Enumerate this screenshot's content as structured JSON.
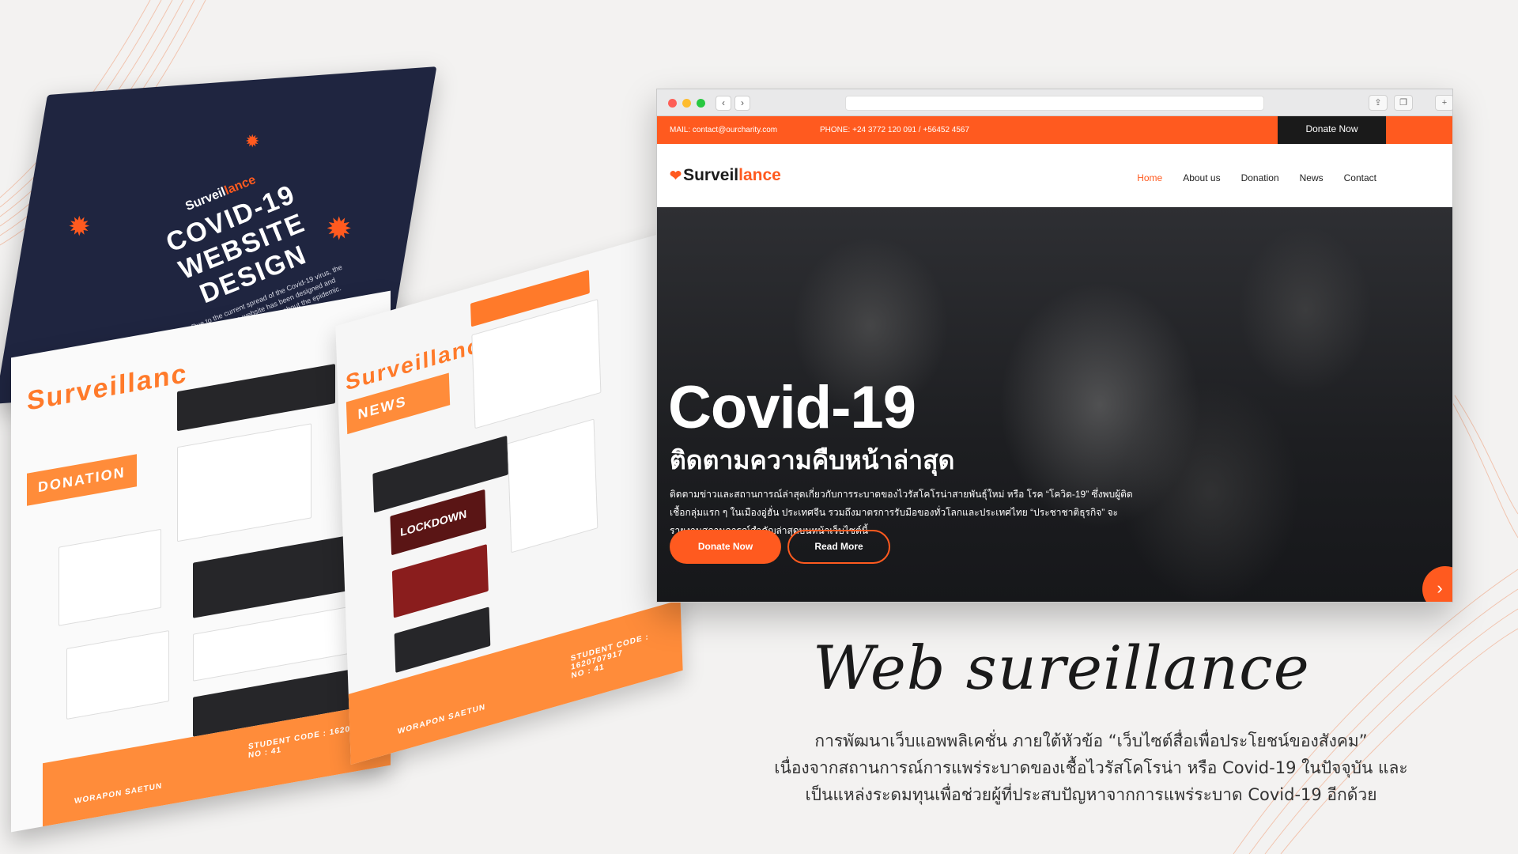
{
  "colors": {
    "accent": "#ff5a1f",
    "dark": "#1a1a1a",
    "navy": "#1f2540",
    "background": "#f3f2f1"
  },
  "magazine": {
    "cover": {
      "logo_prefix": "Surveil",
      "logo_accent": "lance",
      "title_line1": "COVID-19",
      "title_line2": "WEBSITE DESIGN",
      "description": "Due to the current spread of the Covid-19 virus, the surveillance website has been designed and developed to report news about the epidemic."
    },
    "left_page": {
      "title": "Surveillanc",
      "section": "DONATION",
      "student_code": "STUDENT CODE : 1620707917",
      "number": "NO : 41",
      "author": "WORAPON SAETUN"
    },
    "right_page": {
      "title": "Surveillanc",
      "section": "NEWS",
      "lockdown": "LOCKDOWN",
      "student_code": "STUDENT CODE : 1620707917",
      "number": "NO : 41",
      "author": "WORAPON SAETUN"
    }
  },
  "browser": {
    "nav_back_icon": "chevron-left-icon",
    "nav_forward_icon": "chevron-right-icon",
    "topbar": {
      "mail": "MAIL: contact@ourcharity.com",
      "phone": "PHONE: +24 3772 120 091 / +56452 4567",
      "donate_label": "Donate Now"
    },
    "site": {
      "logo_prefix": "Surveil",
      "logo_accent": "lance",
      "menu": [
        "Home",
        "About us",
        "Donation",
        "News",
        "Contact"
      ]
    },
    "hero": {
      "title": "Covid-19",
      "subtitle": "ติดตามความคืบหน้าล่าสุด",
      "body": "ติดตามข่าวและสถานการณ์ล่าสุดเกี่ยวกับการระบาดของไวรัสโคโรน่าสายพันธุ์ใหม่ หรือ โรค “โควิด-19” ซึ่งพบผู้ติดเชื้อกลุ่มแรก ๆ ในเมืองอู่ฮั่น ประเทศจีน รวมถึงมาตรการรับมือของทั่วโลกและประเทศไทย “ประชาชาติธุรกิจ” จะรายงานสถานการณ์สำคัญล่าสุดบนหน้าเว็บไซต์นี้",
      "donate_button": "Donate Now",
      "read_button": "Read More"
    }
  },
  "caption": {
    "script_title": "Web sureillance",
    "line1": "การพัฒนาเว็บแอพพลิเคชั่น ภายใต้หัวข้อ “เว็บไซต์สื่อเพื่อประโยชน์ของสังคม”",
    "line2": "เนื่องจากสถานการณ์การแพร่ระบาดของเชื้อไวรัสโคโรน่า หรือ Covid-19 ในปัจจุบัน และ",
    "line3": "เป็นแหล่งระดมทุนเพื่อช่วยผู้ที่ประสบปัญหาจากการแพร่ระบาด Covid-19 อีกด้วย"
  }
}
